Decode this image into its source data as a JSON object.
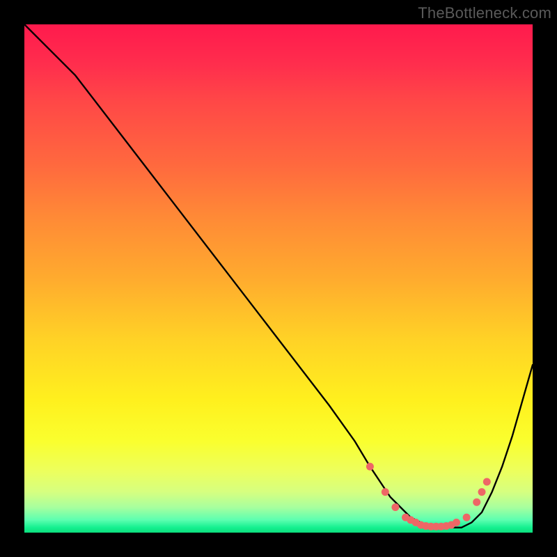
{
  "watermark": "TheBottleneck.com",
  "chart_data": {
    "type": "line",
    "title": "",
    "xlabel": "",
    "ylabel": "",
    "xlim": [
      0,
      100
    ],
    "ylim": [
      0,
      100
    ],
    "grid": false,
    "legend": false,
    "series": [
      {
        "name": "bottleneck-curve",
        "color": "#000000",
        "x": [
          0,
          6,
          10,
          20,
          30,
          40,
          50,
          60,
          65,
          68,
          70,
          72,
          74,
          76,
          78,
          80,
          82,
          84,
          86,
          88,
          90,
          92,
          94,
          96,
          98,
          100
        ],
        "values": [
          100,
          94,
          90,
          77,
          64,
          51,
          38,
          25,
          18,
          13,
          10,
          7,
          5,
          3,
          2,
          1,
          1,
          1,
          1,
          2,
          4,
          8,
          13,
          19,
          26,
          33
        ]
      }
    ],
    "markers": {
      "name": "highlight-points",
      "color": "#ee6666",
      "x": [
        68,
        71,
        73,
        75,
        76,
        77,
        78,
        79,
        80,
        81,
        82,
        83,
        84,
        85,
        87,
        89,
        90,
        91
      ],
      "values": [
        13,
        8,
        5,
        3,
        2.5,
        2,
        1.5,
        1.3,
        1.2,
        1.2,
        1.2,
        1.3,
        1.5,
        2,
        3,
        6,
        8,
        10
      ]
    }
  }
}
